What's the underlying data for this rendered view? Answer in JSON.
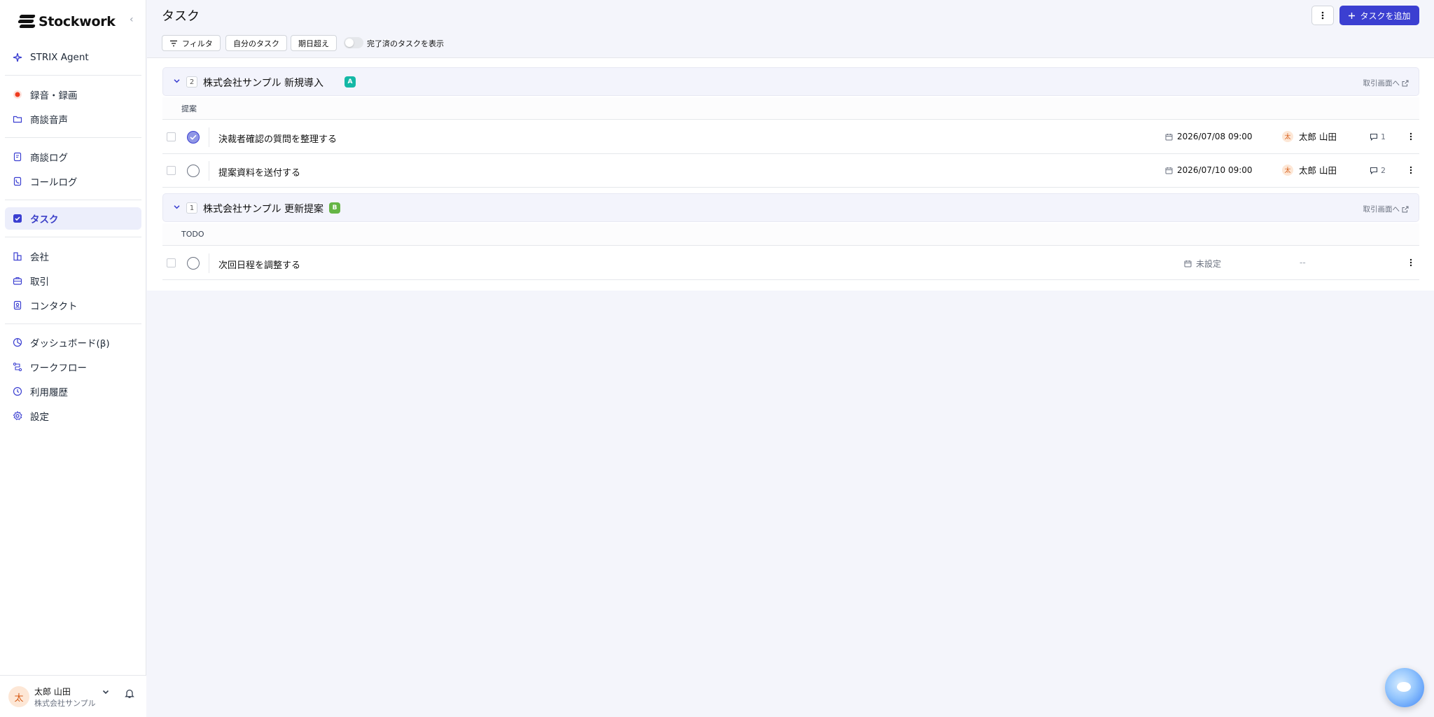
{
  "app": {
    "name": "Stockwork"
  },
  "sidebar": {
    "items": [
      {
        "label": "STRIX Agent",
        "icon": "sparkle-icon"
      },
      {
        "label": "録音・録画",
        "icon": "record-icon"
      },
      {
        "label": "商談音声",
        "icon": "folder-icon"
      },
      {
        "label": "商談ログ",
        "icon": "document-icon"
      },
      {
        "label": "コールログ",
        "icon": "phone-icon"
      },
      {
        "label": "タスク",
        "icon": "checkbox-icon",
        "active": true
      },
      {
        "label": "会社",
        "icon": "building-icon"
      },
      {
        "label": "取引",
        "icon": "briefcase-icon"
      },
      {
        "label": "コンタクト",
        "icon": "contact-icon"
      },
      {
        "label": "ダッシュボード(β)",
        "icon": "chart-icon"
      },
      {
        "label": "ワークフロー",
        "icon": "workflow-icon"
      },
      {
        "label": "利用履歴",
        "icon": "clock-icon"
      },
      {
        "label": "設定",
        "icon": "gear-icon"
      }
    ],
    "user": {
      "avatar_initial": "太",
      "name": "太郎 山田",
      "org": "株式会社サンプル"
    }
  },
  "header": {
    "title": "タスク",
    "add_button": "タスクを追加",
    "filters": {
      "filter": "フィルタ",
      "mine": "自分のタスク",
      "overdue": "期日超え"
    },
    "toggle_label": "完了済のタスクを表示"
  },
  "groups": [
    {
      "count": "2",
      "title": "株式会社サンプル 新規導入",
      "badge": "A",
      "badge_color": "#14b8a6",
      "link": "取引画面へ",
      "stage": "提案",
      "tasks": [
        {
          "name": "決裁者確認の質問を整理する",
          "due": "2026/07/08 09:00",
          "assignee_initial": "太",
          "assignee": "太郎 山田",
          "comments": "1",
          "done": true
        },
        {
          "name": "提案資料を送付する",
          "due": "2026/07/10 09:00",
          "assignee_initial": "太",
          "assignee": "太郎 山田",
          "comments": "2",
          "done": false
        }
      ]
    },
    {
      "count": "1",
      "title": "株式会社サンプル 更新提案",
      "badge": "B",
      "badge_color": "#65b545",
      "link": "取引画面へ",
      "stage": "TODO",
      "tasks": [
        {
          "name": "次回日程を調整する",
          "due": "未設定",
          "assignee": "--",
          "done": false
        }
      ]
    }
  ]
}
